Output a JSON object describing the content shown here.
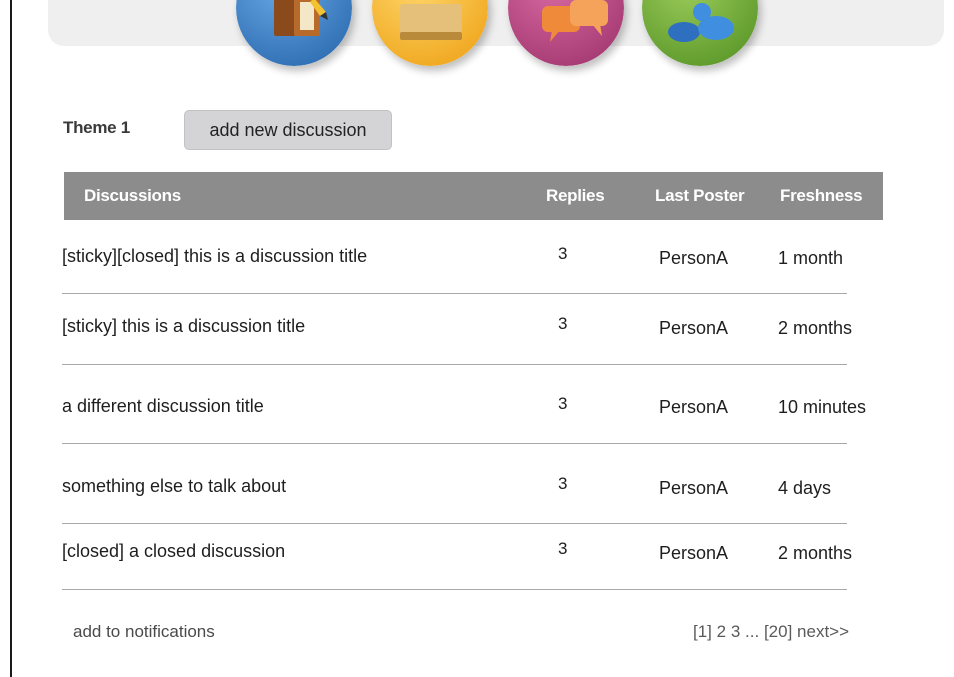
{
  "nav_icons": [
    {
      "name": "book-pencil-icon",
      "color": "#3d7fc4"
    },
    {
      "name": "folder-icon",
      "color": "#f0b430"
    },
    {
      "name": "chat-bubbles-icon",
      "color": "#b9457f"
    },
    {
      "name": "people-icon",
      "color": "#6aa33a"
    }
  ],
  "section": {
    "title": "Theme 1",
    "add_button_label": "add new discussion"
  },
  "table": {
    "headers": {
      "discussions": "Discussions",
      "replies": "Replies",
      "last_poster": "Last Poster",
      "freshness": "Freshness"
    },
    "rows": [
      {
        "title": "[sticky][closed] this is a discussion title",
        "replies": "3",
        "last_poster": "PersonA",
        "freshness": "1 month"
      },
      {
        "title": "[sticky] this is a discussion title",
        "replies": "3",
        "last_poster": "PersonA",
        "freshness": "2 months"
      },
      {
        "title": "a different discussion title",
        "replies": "3",
        "last_poster": "PersonA",
        "freshness": "10 minutes"
      },
      {
        "title": "something else to talk about",
        "replies": "3",
        "last_poster": "PersonA",
        "freshness": "4 days"
      },
      {
        "title": "[closed] a closed discussion",
        "replies": "3",
        "last_poster": "PersonA",
        "freshness": "2 months"
      }
    ]
  },
  "footer": {
    "notifications_link": "add to notifications",
    "pagination": {
      "current": "[1]",
      "page2": "2",
      "page3": "3",
      "ellipsis": "...",
      "last": "[20]",
      "next": "next>>"
    }
  },
  "colors": {
    "header_bg": "#8c8c8c",
    "button_bg": "#d4d4d6",
    "top_bar_bg": "#efefef"
  }
}
